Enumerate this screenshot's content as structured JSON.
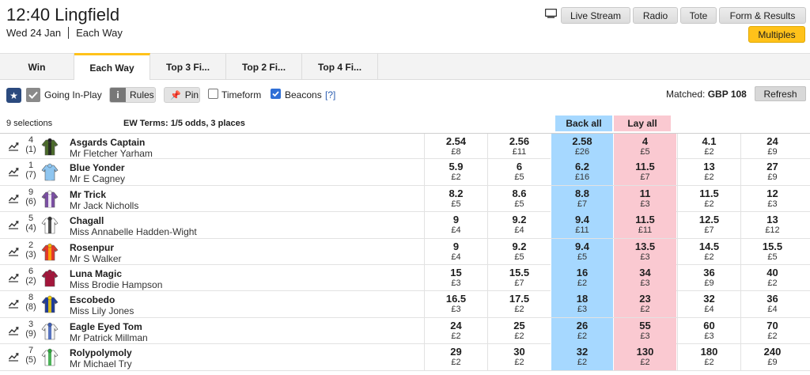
{
  "header": {
    "title": "12:40 Lingfield",
    "date": "Wed 24 Jan",
    "market": "Each Way",
    "buttons": {
      "live_stream": "Live Stream",
      "radio": "Radio",
      "tote": "Tote",
      "form_results": "Form & Results"
    },
    "multiples": "Multiples"
  },
  "tabs": [
    "Win",
    "Each Way",
    "Top 3 Fi...",
    "Top 2 Fi...",
    "Top 4 Fi..."
  ],
  "toolbar": {
    "going_in_play": "Going In-Play",
    "rules": "Rules",
    "pin": "Pin",
    "timeform": "Timeform",
    "beacons": "Beacons",
    "help": "[?]",
    "matched_label": "Matched:",
    "matched_value": "GBP 108",
    "refresh": "Refresh"
  },
  "market_info": {
    "selections": "9 selections",
    "ew_terms": "EW Terms: 1/5 odds, 3 places",
    "back_all": "Back all",
    "lay_all": "Lay all"
  },
  "colors": {
    "back": "#a6d8ff",
    "lay": "#fac9d1",
    "accent": "#ffc21a"
  },
  "runners": [
    {
      "num": "4",
      "draw": "(1)",
      "name": "Asgards Captain",
      "jockey": "Mr Fletcher Yarham",
      "prices": [
        [
          "2.54",
          "£8"
        ],
        [
          "2.56",
          "£11"
        ],
        [
          "2.58",
          "£26"
        ],
        [
          "4",
          "£5"
        ],
        [
          "4.1",
          "£2"
        ],
        [
          "24",
          "£9"
        ]
      ]
    },
    {
      "num": "1",
      "draw": "(7)",
      "name": "Blue Yonder",
      "jockey": "Mr E Cagney",
      "prices": [
        [
          "5.9",
          "£2"
        ],
        [
          "6",
          "£5"
        ],
        [
          "6.2",
          "£16"
        ],
        [
          "11.5",
          "£7"
        ],
        [
          "13",
          "£2"
        ],
        [
          "27",
          "£9"
        ]
      ]
    },
    {
      "num": "9",
      "draw": "(6)",
      "name": "Mr Trick",
      "jockey": "Mr Jack Nicholls",
      "prices": [
        [
          "8.2",
          "£5"
        ],
        [
          "8.6",
          "£5"
        ],
        [
          "8.8",
          "£7"
        ],
        [
          "11",
          "£3"
        ],
        [
          "11.5",
          "£2"
        ],
        [
          "12",
          "£3"
        ]
      ]
    },
    {
      "num": "5",
      "draw": "(4)",
      "name": "Chagall",
      "jockey": "Miss Annabelle Hadden-Wight",
      "prices": [
        [
          "9",
          "£4"
        ],
        [
          "9.2",
          "£4"
        ],
        [
          "9.4",
          "£11"
        ],
        [
          "11.5",
          "£11"
        ],
        [
          "12.5",
          "£7"
        ],
        [
          "13",
          "£12"
        ]
      ]
    },
    {
      "num": "2",
      "draw": "(3)",
      "name": "Rosenpur",
      "jockey": "Mr S Walker",
      "prices": [
        [
          "9",
          "£4"
        ],
        [
          "9.2",
          "£5"
        ],
        [
          "9.4",
          "£5"
        ],
        [
          "13.5",
          "£3"
        ],
        [
          "14.5",
          "£2"
        ],
        [
          "15.5",
          "£5"
        ]
      ]
    },
    {
      "num": "6",
      "draw": "(2)",
      "name": "Luna Magic",
      "jockey": "Miss Brodie Hampson",
      "prices": [
        [
          "15",
          "£3"
        ],
        [
          "15.5",
          "£7"
        ],
        [
          "16",
          "£2"
        ],
        [
          "34",
          "£3"
        ],
        [
          "36",
          "£9"
        ],
        [
          "40",
          "£2"
        ]
      ]
    },
    {
      "num": "8",
      "draw": "(8)",
      "name": "Escobedo",
      "jockey": "Miss Lily Jones",
      "prices": [
        [
          "16.5",
          "£3"
        ],
        [
          "17.5",
          "£2"
        ],
        [
          "18",
          "£3"
        ],
        [
          "23",
          "£2"
        ],
        [
          "32",
          "£4"
        ],
        [
          "36",
          "£4"
        ]
      ]
    },
    {
      "num": "3",
      "draw": "(9)",
      "name": "Eagle Eyed Tom",
      "jockey": "Mr Patrick Millman",
      "prices": [
        [
          "24",
          "£2"
        ],
        [
          "25",
          "£2"
        ],
        [
          "26",
          "£2"
        ],
        [
          "55",
          "£3"
        ],
        [
          "60",
          "£3"
        ],
        [
          "70",
          "£2"
        ]
      ]
    },
    {
      "num": "7",
      "draw": "(5)",
      "name": "Rolypolymoly",
      "jockey": "Mr Michael Try",
      "prices": [
        [
          "29",
          "£2"
        ],
        [
          "30",
          "£2"
        ],
        [
          "32",
          "£2"
        ],
        [
          "130",
          "£2"
        ],
        [
          "180",
          "£2"
        ],
        [
          "240",
          "£9"
        ]
      ]
    }
  ]
}
